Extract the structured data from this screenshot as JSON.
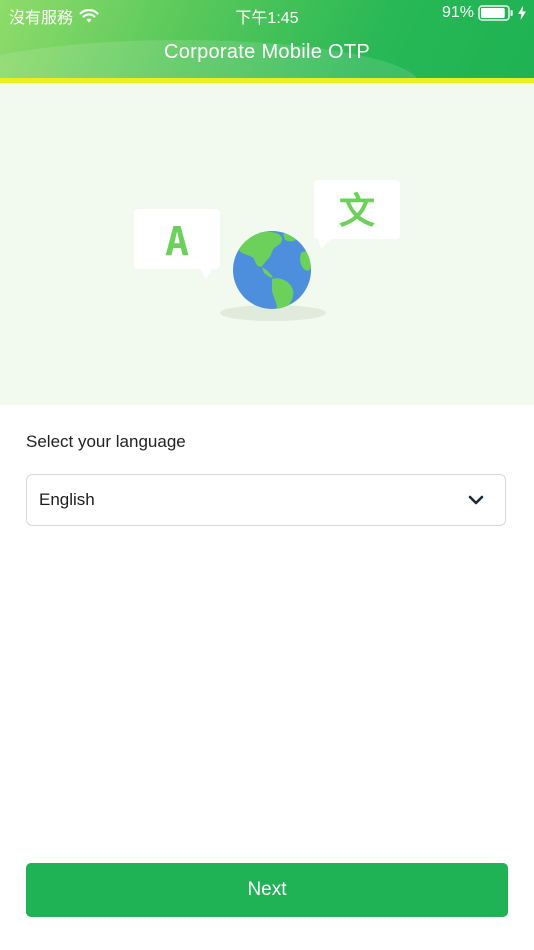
{
  "status_bar": {
    "carrier": "沒有服務",
    "time": "下午1:45",
    "battery": "91%",
    "battery_level": 0.91,
    "icons": [
      "wifi-icon",
      "battery-icon",
      "charging-bolt-icon"
    ]
  },
  "header": {
    "title": "Corporate Mobile OTP",
    "accent_stripe_color": "#e8f01e"
  },
  "hero": {
    "bubble_left_glyph": "A",
    "bubble_right_glyph": "文",
    "glyph_color": "#6bd15a",
    "icons": [
      "translation-bubble-icon",
      "globe-icon"
    ]
  },
  "language": {
    "label": "Select your language",
    "selected": "English"
  },
  "actions": {
    "next_label": "Next"
  },
  "colors": {
    "brand_green": "#1fb356",
    "hero_background": "#f2f9ef",
    "globe_ocean": "#4d8fdc",
    "globe_land": "#6bd15a"
  }
}
